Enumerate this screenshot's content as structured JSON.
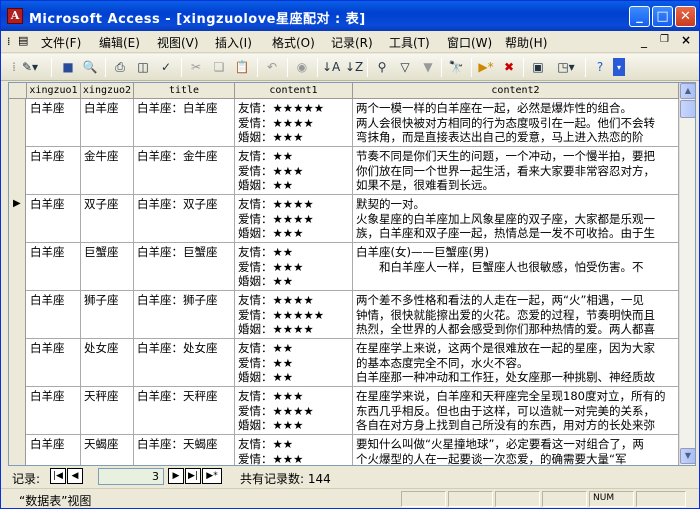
{
  "window": {
    "title": "Microsoft Access - [xingzuolove星座配对 : 表]",
    "icon_letter": "A"
  },
  "menu": [
    "文件(F)",
    "编辑(E)",
    "视图(V)",
    "插入(I)",
    "格式(O)",
    "记录(R)",
    "工具(T)",
    "窗口(W)",
    "帮助(H)"
  ],
  "columns": [
    "xingzuo1",
    "xingzuo2",
    "title",
    "content1",
    "content2"
  ],
  "rows": [
    {
      "x1": "白羊座",
      "x2": "白羊座",
      "title": "白羊座：白羊座",
      "c1": [
        "友情：★★★★★",
        "爱情：★★★★",
        "婚姻：★★★"
      ],
      "c2": [
        "两个一模一样的白羊座在一起，必然是爆炸性的组合。",
        "两人会很快被对方相同的行为态度吸引在一起。他们不会转",
        "弯抹角，而是直接表达出自己的爱意，马上进入热恋的阶"
      ],
      "current": false
    },
    {
      "x1": "白羊座",
      "x2": "金牛座",
      "title": "白羊座：金牛座",
      "c1": [
        "友情：★★",
        "爱情：★★★",
        "婚姻：★★"
      ],
      "c2": [
        "节奏不同是你们天生的问题，一个冲动，一个慢半拍，要把",
        "你们放在同一个世界一起生活，看来大家要非常容忍对方，",
        "如果不是，很难看到长远。"
      ],
      "current": false
    },
    {
      "x1": "白羊座",
      "x2": "双子座",
      "title": "白羊座：双子座",
      "c1": [
        "友情：★★★★",
        "爱情：★★★★",
        "婚姻：★★★"
      ],
      "c2": [
        "默契的一对。",
        "火象星座的白羊座加上风象星座的双子座，大家都是乐观一",
        "族，白羊座和双子座一起，热情总是一发不可收拾。由于生"
      ],
      "current": true
    },
    {
      "x1": "白羊座",
      "x2": "巨蟹座",
      "title": "白羊座：巨蟹座",
      "c1": [
        "友情：★★",
        "爱情：★★★",
        "婚姻：★★"
      ],
      "c2": [
        "白羊座(女)——巨蟹座(男)",
        "",
        "　　和白羊座人一样，巨蟹座人也很敏感，怕受伤害。不"
      ],
      "current": false
    },
    {
      "x1": "白羊座",
      "x2": "狮子座",
      "title": "白羊座：狮子座",
      "c1": [
        "友情：★★★★",
        "爱情：★★★★★",
        "婚姻：★★★★"
      ],
      "c2": [
        "两个差不多性格和看法的人走在一起，两“火”相遇，一见",
        "钟情，很快就能擦出爱的火花。恋爱的过程，节奏明快而且",
        "热烈，全世界的人都会感受到你们那种热情的爱。两人都喜"
      ],
      "current": false
    },
    {
      "x1": "白羊座",
      "x2": "处女座",
      "title": "白羊座：处女座",
      "c1": [
        "友情：★★",
        "爱情：★★",
        "婚姻：★★"
      ],
      "c2": [
        "在星座学上来说，这两个是很难放在一起的星座，因为大家",
        "的基本态度完全不同，水火不容。",
        "白羊座那一种冲动和工作狂，处女座那一种挑剔、神经质故"
      ],
      "current": false
    },
    {
      "x1": "白羊座",
      "x2": "天秤座",
      "title": "白羊座：天秤座",
      "c1": [
        "友情：★★★",
        "爱情：★★★★",
        "婚姻：★★★"
      ],
      "c2": [
        "在星座学来说，白羊座和天秤座完全呈现180度对立，所有的",
        "东西几乎相反。但也由于这样，可以造就一对完美的关系，",
        "各自在对方身上找到自己所没有的东西，用对方的长处来弥"
      ],
      "current": false
    },
    {
      "x1": "白羊座",
      "x2": "天蝎座",
      "title": "白羊座：天蝎座",
      "c1": [
        "友情：★★",
        "爱情：★★★",
        "婚姻：★★"
      ],
      "c2": [
        "要知什么叫做“火星撞地球”，必定要看这一对组合了，两",
        "个火爆型的人在一起要谈一次恋爱，的确需要大量“军",
        ""
      ],
      "current": false
    }
  ],
  "nav": {
    "label": "记录:",
    "current": "3",
    "total_label": "共有记录数: 144"
  },
  "status": {
    "view": "“数据表”视图",
    "num": "NUM"
  }
}
